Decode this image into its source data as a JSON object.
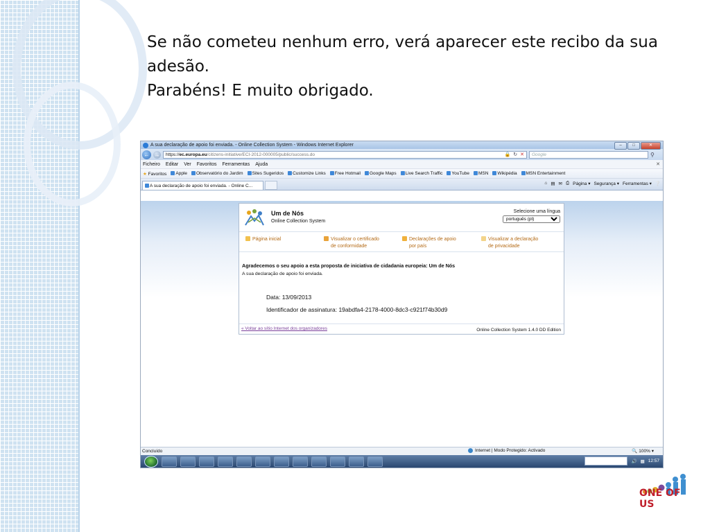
{
  "slide": {
    "caption_lines": [
      "Se não cometeu nenhum erro, verá aparecer este recibo da sua",
      "adesão.",
      "Parabéns! E muito obrigado."
    ],
    "logo_text": "ONE OF US",
    "colors": {
      "strip": "#cfe2f1",
      "logo_red": "#c01f2b"
    }
  },
  "browser": {
    "window_title": "A sua declaração de apoio foi enviada. - Online Collection System - Windows Internet Explorer",
    "window_buttons": [
      "–",
      "□",
      "✕"
    ],
    "address": {
      "scheme": "https://",
      "host": "ec.europa.eu",
      "path": "/citizens-initiative/ECI-2012-000005/public/success.do"
    },
    "search_placeholder": "Google",
    "menu": [
      "Ficheiro",
      "Editar",
      "Ver",
      "Favoritos",
      "Ferramentas",
      "Ajuda"
    ],
    "favorites": {
      "label": "Favoritos",
      "items": [
        "Apple",
        "Observatório do Jardim",
        "Sites Sugeridos",
        "Customize Links",
        "Free Hotmail",
        "Google Maps",
        "Live Search Traffic",
        "YouTube",
        "MSN",
        "Wikipédia",
        "MSN Entertainment"
      ]
    },
    "tab_title": "A sua declaração de apoio foi enviada. - Online C...",
    "command_bar": [
      "Página ▾",
      "Segurança ▾",
      "Ferramentas ▾"
    ],
    "status": {
      "left": "Concluído",
      "zone": "Internet | Modo Protegido: Activado",
      "zoom": "100%"
    },
    "clock": "12:57"
  },
  "page": {
    "brand_name": "Um de Nós",
    "brand_sub": "Online Collection System",
    "lang_label": "Selecione uma língua",
    "lang_value": "português (pt)",
    "nav": [
      {
        "line1": "Página inicial",
        "line2": ""
      },
      {
        "line1": "Visualizar o certificado",
        "line2": "de conformidade"
      },
      {
        "line1": "Declarações de apoio",
        "line2": "por país"
      },
      {
        "line1": "Visualizar a declaração",
        "line2": "de privacidade"
      }
    ],
    "thanks": "Agradecemos o seu apoio a esta proposta de iniciativa de cidadania europeia: Um de Nós",
    "sent_message": "A sua declaração de apoio foi enviada.",
    "date_label": "Data:",
    "date_value": "13/09/2013",
    "sig_label": "Identificador de assinatura:",
    "sig_value": "19abdfa4-2178-4000-8dc3-c921f74b30d9",
    "back_link": "« Voltar ao sítio Internet dos organizadores",
    "version": "Online Collection System 1.4.0 DD Edition"
  }
}
